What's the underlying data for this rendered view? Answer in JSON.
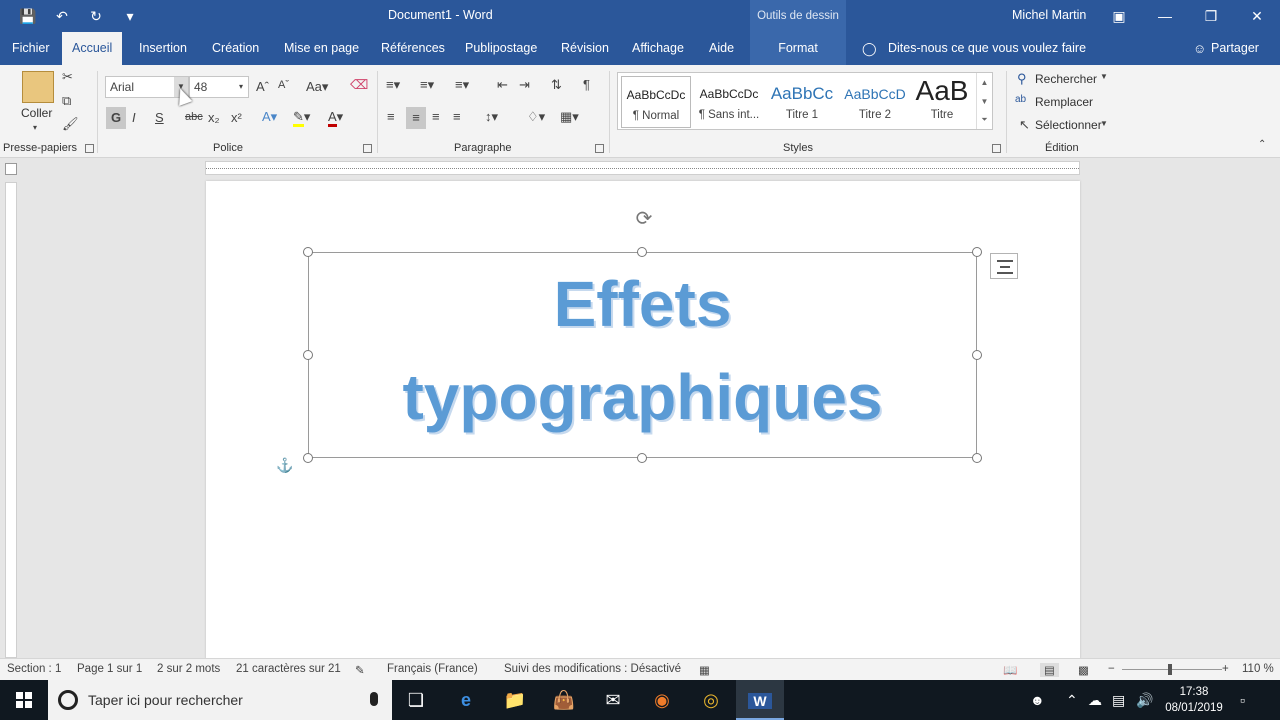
{
  "titlebar": {
    "doc_title": "Document1  -  Word",
    "context_tools": "Outils de dessin",
    "user": "Michel Martin"
  },
  "tabs": {
    "fichier": "Fichier",
    "accueil": "Accueil",
    "insertion": "Insertion",
    "creation": "Création",
    "mise_en_page": "Mise en page",
    "references": "Références",
    "publipostage": "Publipostage",
    "revision": "Révision",
    "affichage": "Affichage",
    "aide": "Aide",
    "format": "Format",
    "tellme": "Dites-nous ce que vous voulez faire",
    "share": "Partager"
  },
  "ribbon": {
    "clipboard": {
      "paste": "Coller",
      "label": "Presse-papiers"
    },
    "font": {
      "name": "Arial",
      "size": "48",
      "label": "Police",
      "bold": "G",
      "italic": "I",
      "underline": "S",
      "strike": "abc",
      "sub": "x₂",
      "sup": "x²",
      "case": "Aa"
    },
    "paragraph": {
      "label": "Paragraphe"
    },
    "styles": {
      "label": "Styles",
      "items": [
        {
          "preview": "AaBbCcDc",
          "name": "¶ Normal"
        },
        {
          "preview": "AaBbCcDc",
          "name": "¶ Sans int..."
        },
        {
          "preview": "AaBbCc",
          "name": "Titre 1"
        },
        {
          "preview": "AaBbCcD",
          "name": "Titre 2"
        },
        {
          "preview": "AaB",
          "name": "Titre"
        }
      ]
    },
    "editing": {
      "find": "Rechercher",
      "replace": "Remplacer",
      "select": "Sélectionner",
      "label": "Édition"
    }
  },
  "document": {
    "wordart_line1": "Effets",
    "wordart_line2": "typographiques"
  },
  "statusbar": {
    "section": "Section : 1",
    "page": "Page 1 sur 1",
    "words": "2 sur 2 mots",
    "chars": "21 caractères sur 21",
    "language": "Français (France)",
    "track": "Suivi des modifications : Désactivé",
    "zoom": "110 %"
  },
  "taskbar": {
    "search_placeholder": "Taper ici pour rechercher",
    "time": "17:38",
    "date": "08/01/2019"
  },
  "colors": {
    "word_blue": "#2b579a",
    "wordart_fill": "#5b9bd5"
  }
}
